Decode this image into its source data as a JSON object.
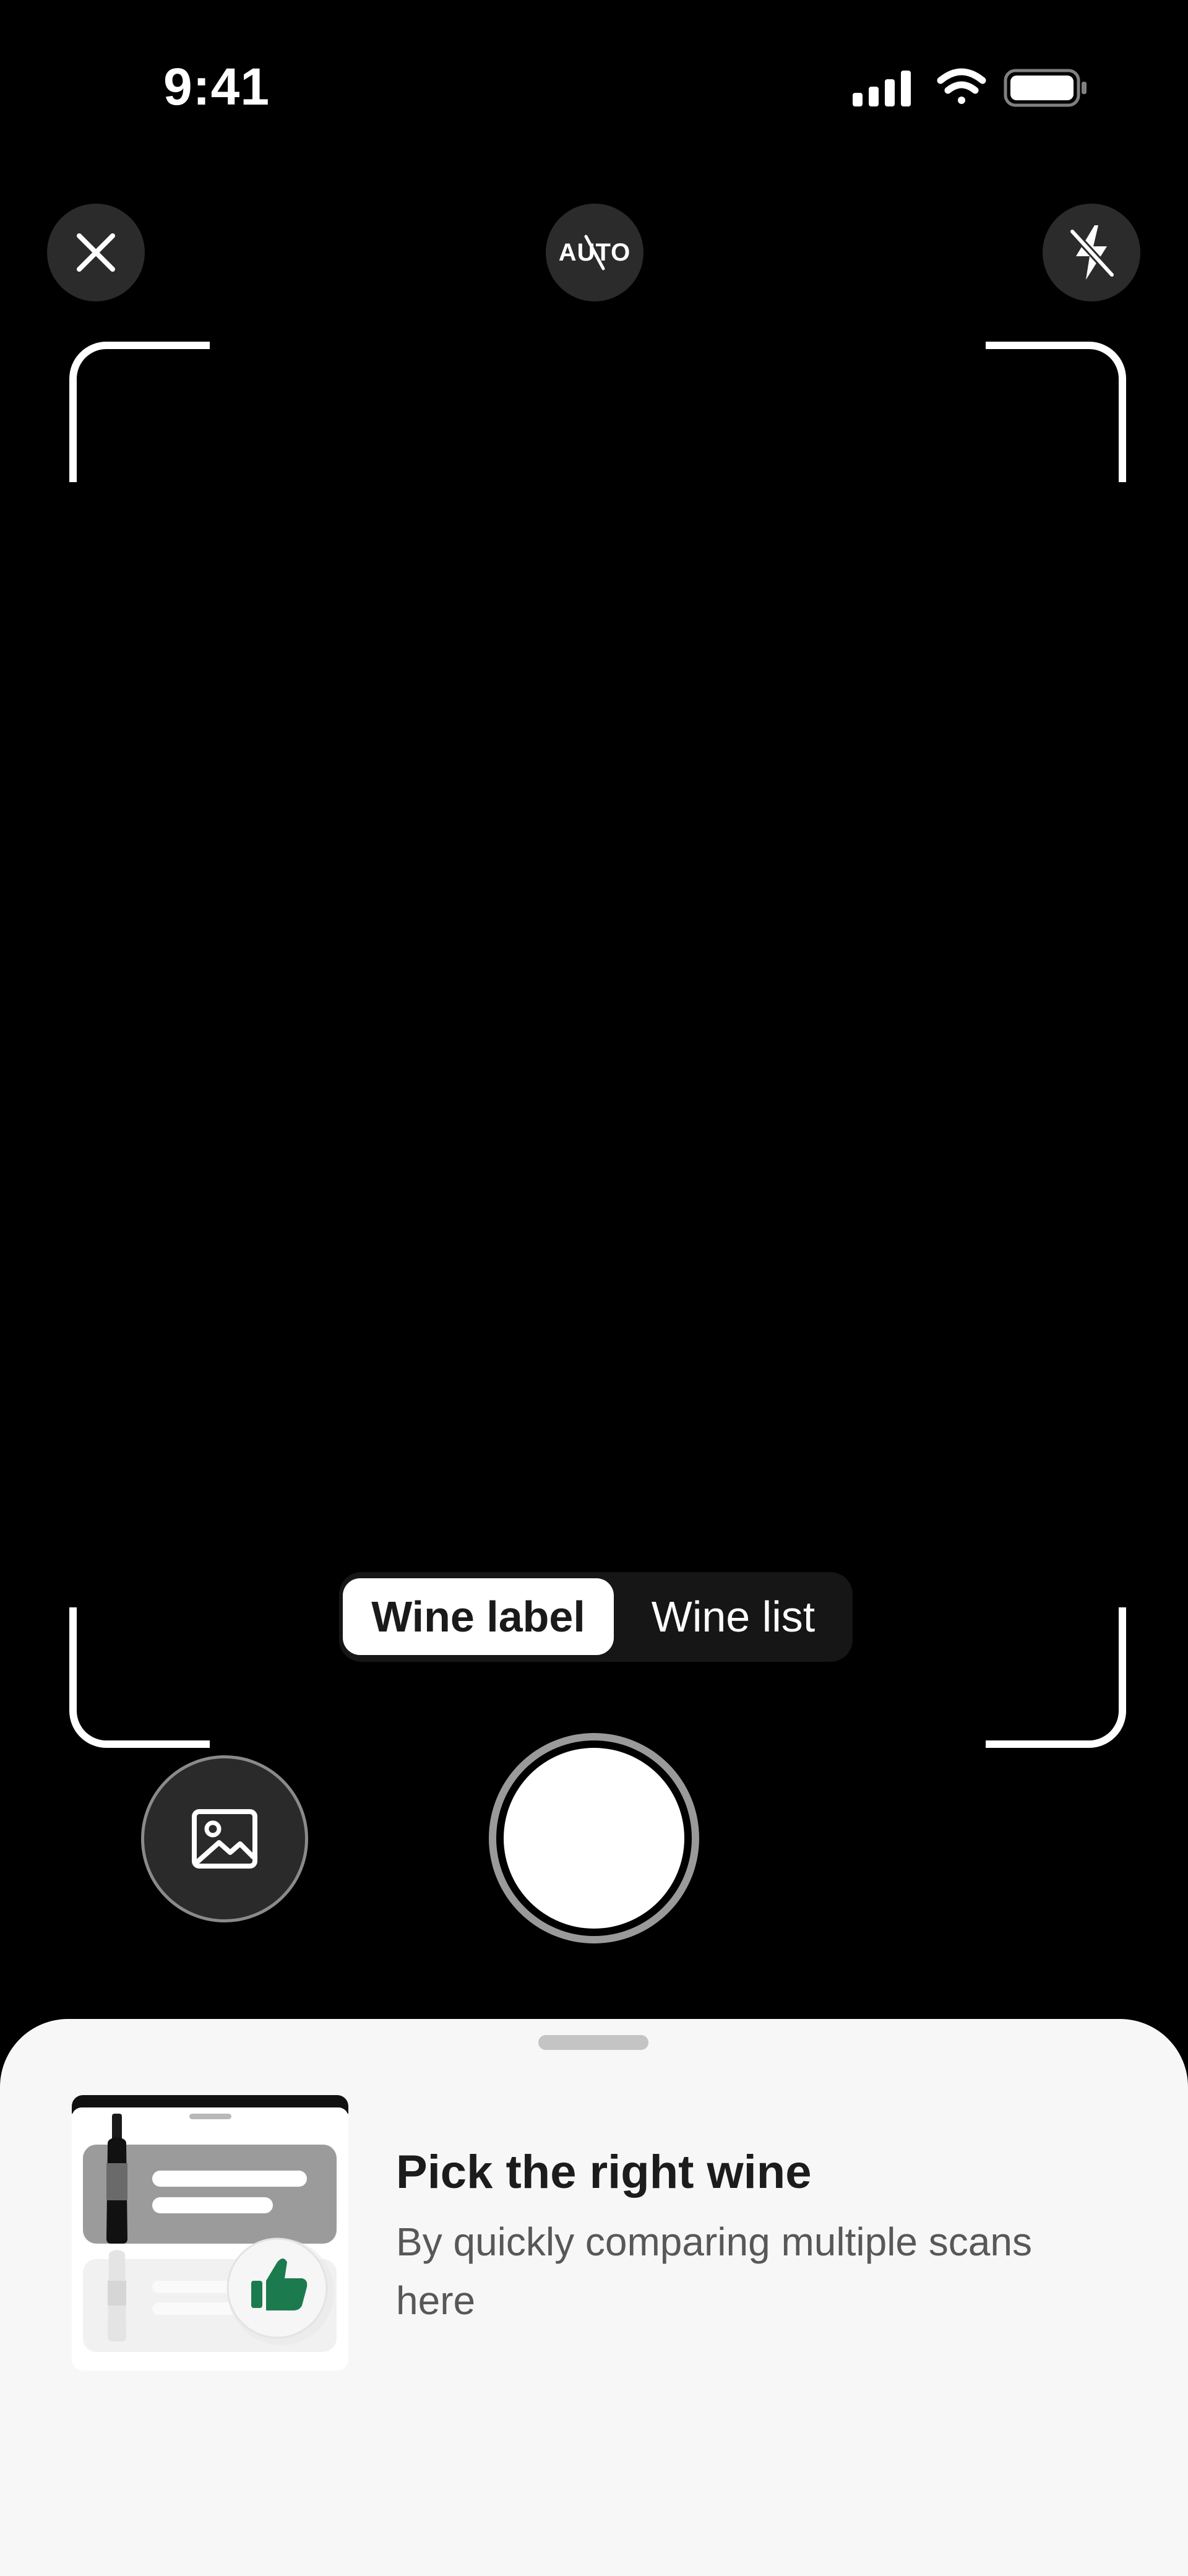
{
  "status_bar": {
    "time": "9:41"
  },
  "top_controls": {
    "close": {
      "icon": "close-icon"
    },
    "auto": {
      "label": "AUTO",
      "icon": "auto-off-icon"
    },
    "flash": {
      "icon": "flash-off-icon"
    }
  },
  "mode_switch": {
    "options": [
      {
        "label": "Wine label",
        "selected": true
      },
      {
        "label": "Wine list",
        "selected": false
      }
    ]
  },
  "bottom_controls": {
    "gallery": {
      "icon": "gallery-icon"
    },
    "shutter": {
      "icon": "shutter-button"
    }
  },
  "promo": {
    "title": "Pick the right wine",
    "subtitle": "By quickly comparing multiple scans here",
    "thumb_icon": "thumbs-up-icon"
  },
  "colors": {
    "background": "#000000",
    "sheet": "#f7f7f7",
    "accent_green": "#1c7a4f",
    "title_text": "#1c1c1c",
    "subtitle_text": "#585858"
  }
}
